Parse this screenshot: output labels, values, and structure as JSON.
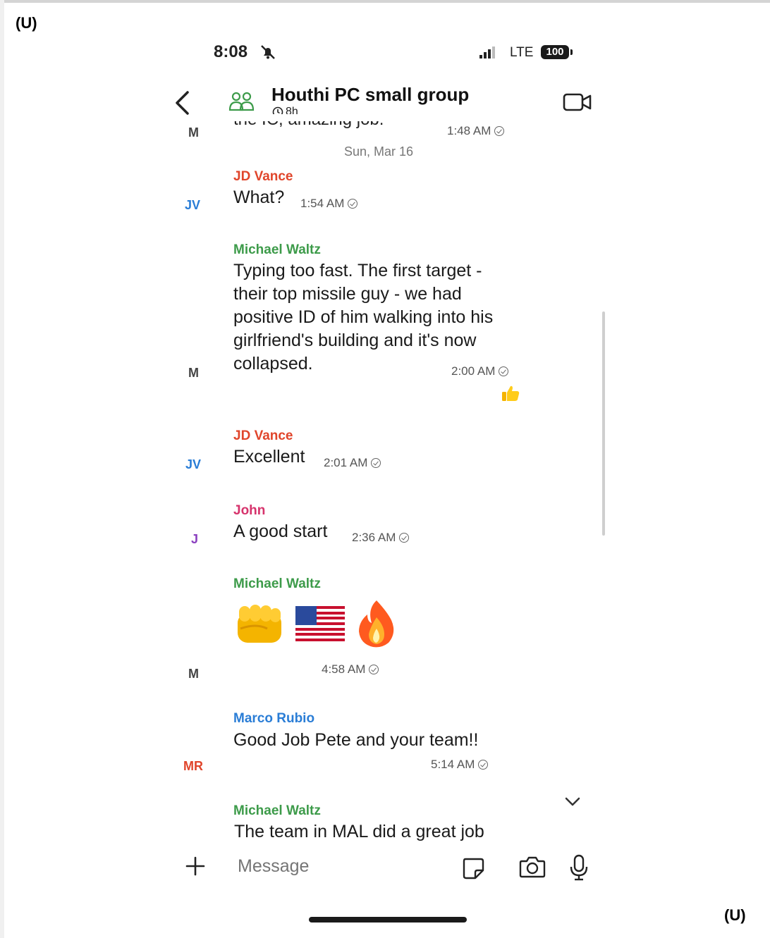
{
  "classification": {
    "top": "(U)",
    "bottom": "(U)"
  },
  "status_bar": {
    "time": "8:08",
    "network": "LTE",
    "battery": "100"
  },
  "header": {
    "title": "Houthi PC small group",
    "timer": "8h"
  },
  "partial_message": {
    "avatar": "M",
    "text": "the IC, amazing job.",
    "time": "1:48 AM"
  },
  "date_separator": "Sun, Mar 16",
  "messages": [
    {
      "avatar": "JV",
      "sender": "JD Vance",
      "text": "What?",
      "time": "1:54 AM"
    },
    {
      "avatar": "M",
      "sender": "Michael Waltz",
      "lines": [
        "Typing too fast. The first target -",
        "their top missile guy - we had",
        "positive ID of him walking into his",
        "girlfriend's building and it's now",
        "collapsed."
      ],
      "time": "2:00 AM",
      "reaction": "thumbs-up"
    },
    {
      "avatar": "JV",
      "sender": "JD Vance",
      "text": "Excellent",
      "time": "2:01 AM"
    },
    {
      "avatar": "J",
      "sender": "John",
      "text": "A good start",
      "time": "2:36 AM"
    },
    {
      "avatar": "M",
      "sender": "Michael Waltz",
      "emojis": [
        "fist",
        "us-flag",
        "fire"
      ],
      "time": "4:58 AM"
    },
    {
      "avatar": "MR",
      "sender": "Marco Rubio",
      "text": "Good Job Pete and your team!!",
      "time": "5:14 AM"
    },
    {
      "sender": "Michael Waltz",
      "text": "The team in MAL did a great job"
    }
  ],
  "composer": {
    "placeholder": "Message"
  },
  "colors": {
    "jd_vance": "#e0452b",
    "michael_waltz": "#3d9b4a",
    "marco_rubio": "#2a7dd6",
    "john": "#d6336c"
  }
}
